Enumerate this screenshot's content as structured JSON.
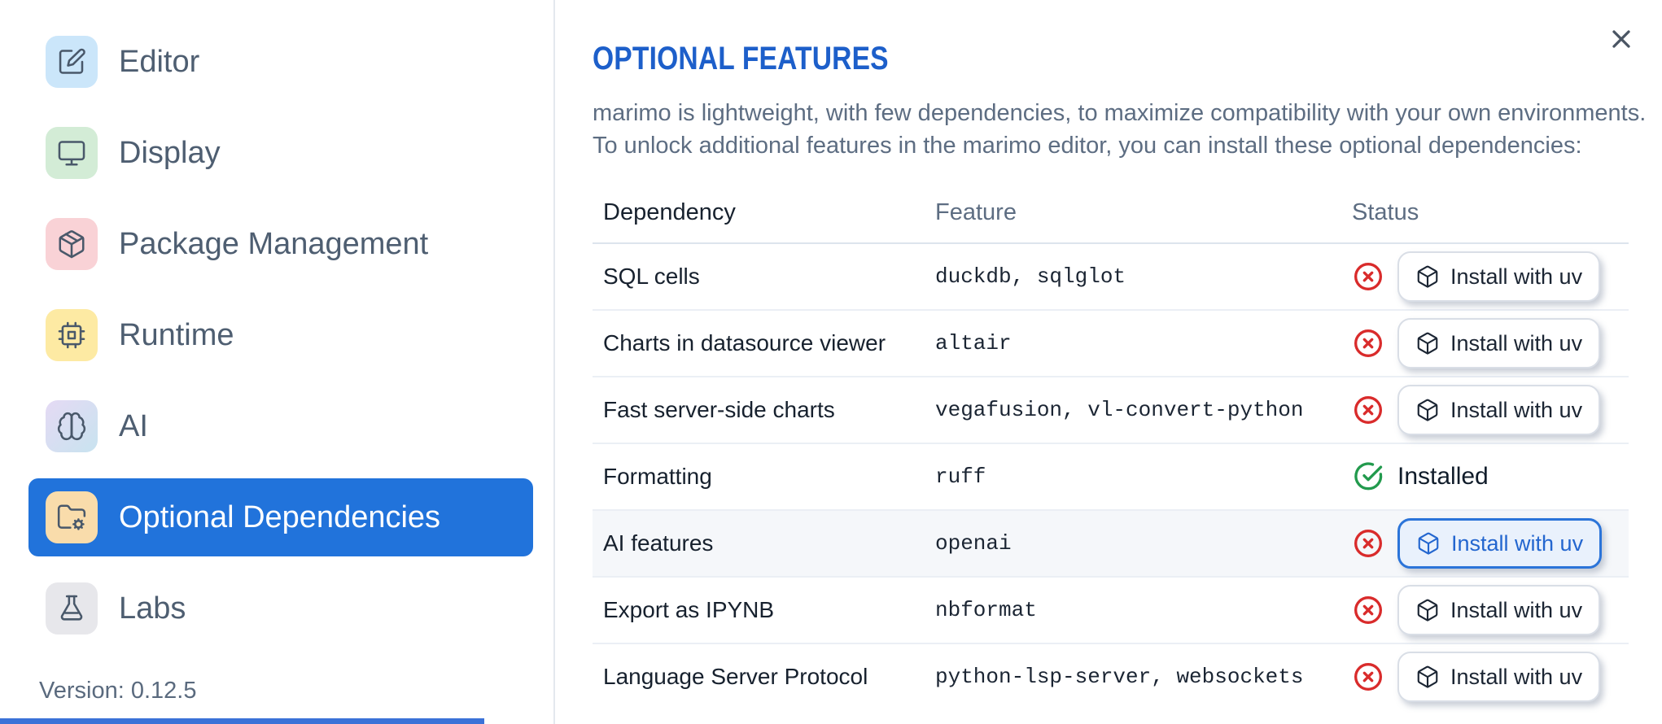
{
  "sidebar": {
    "items": [
      {
        "label": "Editor",
        "icon": "edit",
        "tile": "#cbe6fa"
      },
      {
        "label": "Display",
        "icon": "monitor",
        "tile": "#d3ecd6"
      },
      {
        "label": "Package Management",
        "icon": "package",
        "tile": "#f9d2d6"
      },
      {
        "label": "Runtime",
        "icon": "cpu",
        "tile": "#fdeaa3"
      },
      {
        "label": "AI",
        "icon": "brain",
        "tile_from": "#e5daf4",
        "tile_to": "#c8e3ef"
      },
      {
        "label": "Optional Dependencies",
        "icon": "folder-cog",
        "tile": "#f9dcab",
        "selected": true
      },
      {
        "label": "Labs",
        "icon": "flask",
        "tile": "#e7e7eb"
      }
    ],
    "version": "Version: 0.12.5"
  },
  "panel": {
    "title": "OPTIONAL FEATURES",
    "description_lines": [
      "marimo is lightweight, with few dependencies, to maximize compatibility with your own environments.",
      "To unlock additional features in the marimo editor, you can install these optional dependencies:"
    ]
  },
  "table": {
    "headers": [
      "Dependency",
      "Feature",
      "Status"
    ],
    "install_label": "Install with uv",
    "installed_label": "Installed",
    "rows": [
      {
        "dependency": "SQL cells",
        "feature": "duckdb, sqlglot",
        "status": "missing"
      },
      {
        "dependency": "Charts in datasource viewer",
        "feature": "altair",
        "status": "missing"
      },
      {
        "dependency": "Fast server-side charts",
        "feature": "vegafusion, vl-convert-python",
        "status": "missing"
      },
      {
        "dependency": "Formatting",
        "feature": "ruff",
        "status": "installed"
      },
      {
        "dependency": "AI features",
        "feature": "openai",
        "status": "missing",
        "highlight": true,
        "focused": true
      },
      {
        "dependency": "Export as IPYNB",
        "feature": "nbformat",
        "status": "missing"
      },
      {
        "dependency": "Language Server Protocol",
        "feature": "python-lsp-server, websockets",
        "status": "missing"
      }
    ]
  },
  "colors": {
    "accent_blue": "#2173db",
    "title_blue": "#1d5fca",
    "danger_red": "#d92b2b",
    "success_green": "#229a4d",
    "focus_blue": "#2b74d9"
  }
}
